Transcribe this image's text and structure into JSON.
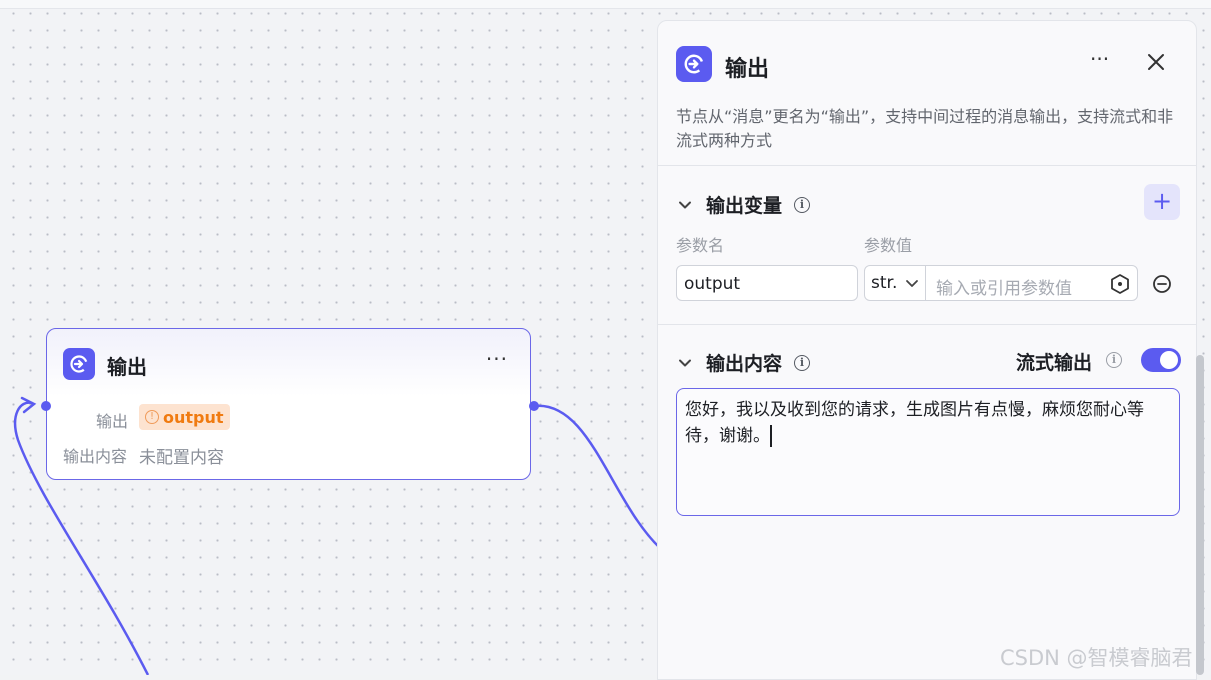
{
  "canvas": {
    "node": {
      "title": "输出",
      "more": "···",
      "row1_label": "输出",
      "tag_text": "output",
      "tag_warn": "!",
      "row2_label": "输出内容",
      "row2_value": "未配置内容"
    }
  },
  "panel": {
    "title": "输出",
    "more": "···",
    "description": "节点从“消息”更名为“输出”，支持中间过程的消息输出，支持流式和非流式两种方式",
    "variables_section": {
      "title": "输出变量",
      "add_label": "+",
      "col_name": "参数名",
      "col_value": "参数值",
      "row": {
        "name": "output",
        "type": "str.",
        "value_placeholder": "输入或引用参数值"
      }
    },
    "content_section": {
      "title": "输出内容",
      "stream_label": "流式输出",
      "stream_enabled": true,
      "text": "您好，我以及收到您的请求，生成图片有点慢，麻烦您耐心等待，谢谢。"
    }
  },
  "watermark": "CSDN @智模睿脑君",
  "colors": {
    "accent": "#5b5bf0",
    "tag_bg": "#fde3d0",
    "tag_text": "#f07b11"
  }
}
